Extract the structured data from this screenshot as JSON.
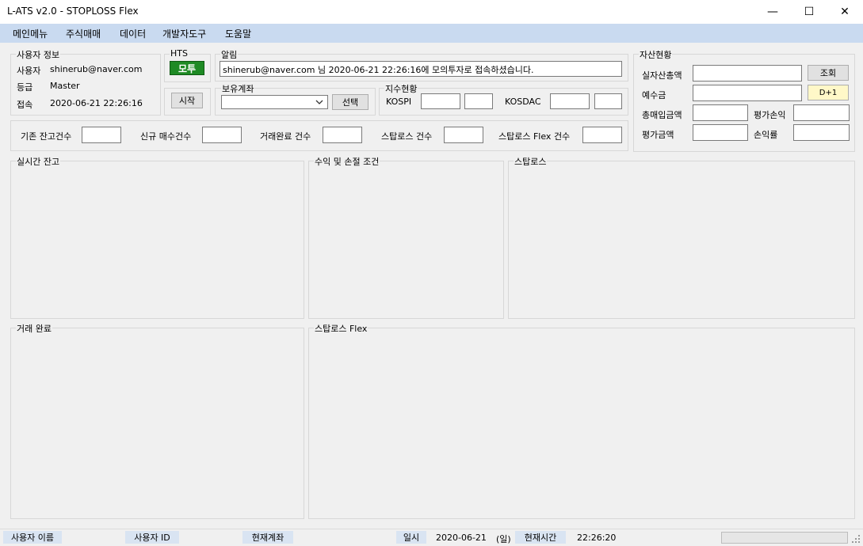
{
  "window": {
    "title": "L-ATS v2.0 - STOPLOSS Flex",
    "minimize": "—",
    "maximize": "☐",
    "close": "✕"
  },
  "menu": [
    "메인메뉴",
    "주식매매",
    "데이터",
    "개발자도구",
    "도움말"
  ],
  "user_info": {
    "title": "사용자 정보",
    "user_label": "사용자",
    "user_value": "shinerub@naver.com",
    "grade_label": "등급",
    "grade_value": "Master",
    "access_label": "접속",
    "access_value": "2020-06-21 22:26:16"
  },
  "hts": {
    "title": "HTS",
    "mode_button": "모투",
    "start_button": "시작"
  },
  "alert": {
    "title": "알림",
    "message": "shinerub@naver.com 님 2020-06-21 22:26:16에 모의투자로 접속하셨습니다."
  },
  "account": {
    "title": "보유계좌",
    "selected": "",
    "select_button": "선택"
  },
  "index": {
    "title": "지수현황",
    "kospi_label": "KOSPI",
    "kosdaq_label": "KOSDAC"
  },
  "counts": {
    "existing": "기존 잔고건수",
    "new_buy": "신규 매수건수",
    "trade_done": "거래완료 건수",
    "stoploss": "스탑로스 건수",
    "stoploss_flex": "스탑로스 Flex 건수"
  },
  "assets": {
    "title": "자산현황",
    "total_label": "실자산총액",
    "query_button": "조회",
    "deposit_label": "예수금",
    "d1_button": "D+1",
    "buy_total_label": "총매입금액",
    "eval_pl_label": "평가손익",
    "eval_amount_label": "평가금액",
    "pl_rate_label": "손익률"
  },
  "panels": {
    "realtime": "실시간 잔고",
    "profit_cond": "수익 및 손절 조건",
    "stoploss": "스탑로스",
    "trade_done": "거래 완료",
    "stoploss_flex": "스탑로스 Flex"
  },
  "status": {
    "user_name": "사용자 이름",
    "user_id": "사용자 ID",
    "current_account": "현재계좌",
    "date_label": "일시",
    "date_value": "2020-06-21",
    "weekday": "(일)",
    "time_label": "현재시간",
    "time_value": "22:26:20"
  },
  "icons": {
    "dropdown": "chevron-down-icon",
    "resize": "resize-grip-icon"
  }
}
